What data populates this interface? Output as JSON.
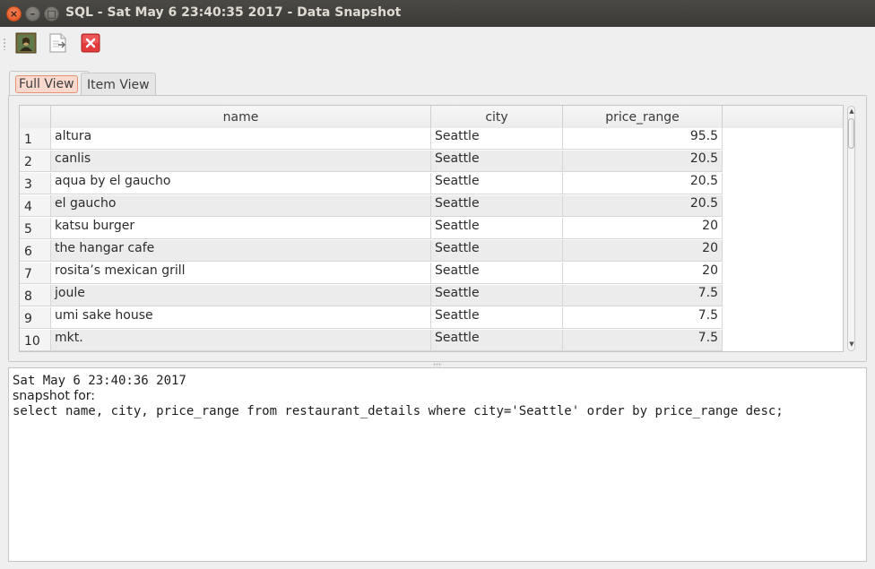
{
  "window": {
    "title": "SQL - Sat May 6 23:40:35 2017 - Data Snapshot",
    "close_glyph": "×",
    "min_glyph": "–",
    "max_glyph": "□"
  },
  "toolbar": {
    "buttons": [
      {
        "icon": "picture-icon"
      },
      {
        "icon": "export-document-icon"
      },
      {
        "icon": "delete-icon"
      }
    ]
  },
  "tabs": [
    {
      "label": "Full View",
      "selected": true
    },
    {
      "label": "Item View",
      "selected": false
    }
  ],
  "table": {
    "columns": [
      "name",
      "city",
      "price_range"
    ],
    "rows": [
      {
        "num": "1",
        "name": "altura",
        "city": "Seattle",
        "price_range": "95.5"
      },
      {
        "num": "2",
        "name": "canlis",
        "city": "Seattle",
        "price_range": "20.5"
      },
      {
        "num": "3",
        "name": "aqua by el gaucho",
        "city": "Seattle",
        "price_range": "20.5"
      },
      {
        "num": "4",
        "name": "el gaucho",
        "city": "Seattle",
        "price_range": "20.5"
      },
      {
        "num": "5",
        "name": "katsu burger",
        "city": "Seattle",
        "price_range": "20"
      },
      {
        "num": "6",
        "name": "the hangar cafe",
        "city": "Seattle",
        "price_range": "20"
      },
      {
        "num": "7",
        "name": "rosita’s mexican grill",
        "city": "Seattle",
        "price_range": "20"
      },
      {
        "num": "8",
        "name": "joule",
        "city": "Seattle",
        "price_range": "7.5"
      },
      {
        "num": "9",
        "name": "umi sake house",
        "city": "Seattle",
        "price_range": "7.5"
      },
      {
        "num": "10",
        "name": "mkt.",
        "city": "Seattle",
        "price_range": "7.5"
      }
    ]
  },
  "log": {
    "timestamp": "Sat May 6 23:40:36 2017",
    "label": "snapshot for:",
    "query": "select name, city, price_range from restaurant_details where city='Seattle' order by price_range desc;"
  },
  "colors": {
    "titlebar": "#3c3b37",
    "close_button": "#e9541f",
    "selected_tab_highlight": "#f9d9ce"
  }
}
